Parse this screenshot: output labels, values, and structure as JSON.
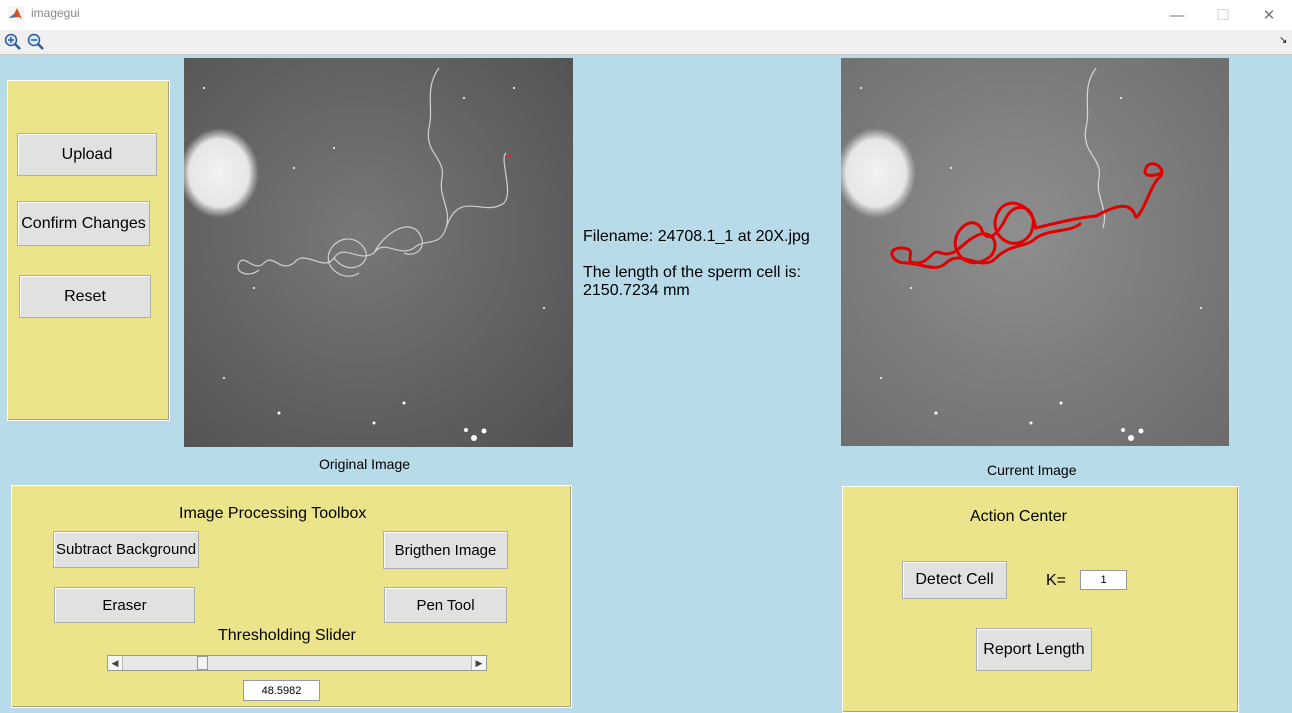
{
  "window": {
    "title": "imagegui",
    "minimize_glyph": "—",
    "maximize_glyph": "☐",
    "close_glyph": "✕"
  },
  "toolbar": {
    "zoom_in_icon": "zoom-in-icon",
    "zoom_out_icon": "zoom-out-icon",
    "corner_glyph": "↘"
  },
  "left_panel": {
    "upload": "Upload",
    "confirm": "Confirm Changes",
    "reset": "Reset"
  },
  "images": {
    "original_caption": "Original Image",
    "current_caption": "Current Image"
  },
  "info": {
    "filename": "Filename: 24708.1_1 at 20X.jpg",
    "length_line1": "The length of the sperm cell is:",
    "length_line2": "2150.7234 mm"
  },
  "toolbox": {
    "title": "Image Processing Toolbox",
    "subtract_background": "Subtract Background",
    "brighten_image": "Brigthen Image",
    "eraser": "Eraser",
    "pen_tool": "Pen Tool",
    "slider_title": "Thresholding Slider",
    "slider_value": "48.5982",
    "slider_fraction": 0.22
  },
  "action_center": {
    "title": "Action Center",
    "detect_cell": "Detect Cell",
    "k_label": "K=",
    "k_value": "1",
    "report_length": "Report Length"
  },
  "colors": {
    "background": "#b7dbe9",
    "panel": "#ebe48b",
    "trace": "#e00000"
  }
}
